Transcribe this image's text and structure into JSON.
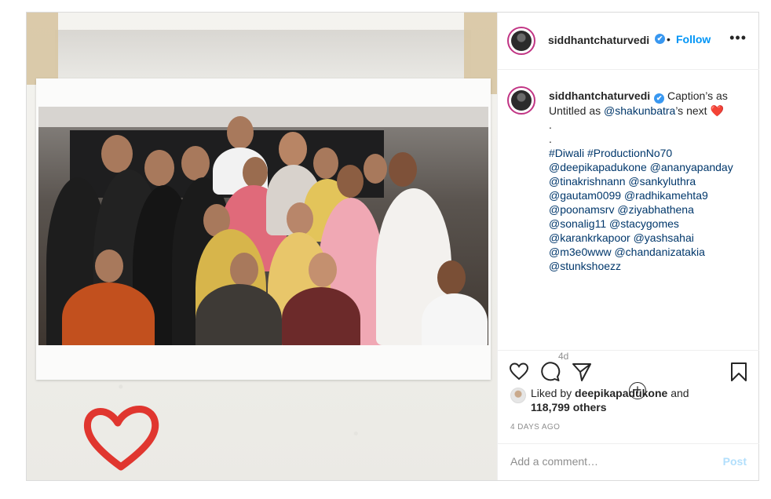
{
  "header": {
    "username": "siddhantchaturvedi",
    "verified_mark": "✔",
    "separator": "•",
    "follow_label": "Follow",
    "more_label": "•••"
  },
  "caption": {
    "username": "siddhantchaturvedi",
    "verified_mark": "✔",
    "line1_prefix": "Caption’s as Untitled as ",
    "mention_main": "@shakunbatra",
    "line1_suffix": "’s next ",
    "heart": "❤️",
    "dot1": ".",
    "dot2": ".",
    "hashtags": "#Diwali #ProductionNo70",
    "mention_lines": [
      "@deepikapadukone @ananyapanday",
      "@tinakrishnann @sankyluthra",
      "@gautam0099 @radhikamehta9",
      "@poonamsrv @ziyabhathena",
      "@sonalig11 @stacygomes",
      "@karankrkapoor @yashsahai",
      "@m3e0www @chandanizatakia",
      "@stunkshoezz"
    ],
    "age": "4d",
    "load_more_symbol": "+"
  },
  "actions": {
    "liked_by_prefix": "Liked by ",
    "liked_by_user": "deepikapadukone",
    "liked_by_and": " and",
    "others": "118,799 others",
    "timestamp": "4 DAYS AGO",
    "comment_placeholder": "Add a comment…",
    "post_label": "Post"
  },
  "icons": {
    "like": "heart-icon",
    "comment": "comment-icon",
    "share": "paper-plane-icon",
    "save": "bookmark-icon"
  },
  "colors": {
    "link": "#0095f6",
    "post_disabled": "#b2dffc",
    "muted": "#8e8e8e"
  }
}
